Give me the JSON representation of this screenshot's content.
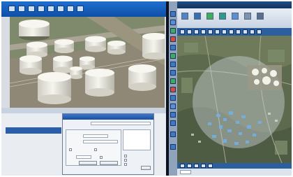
{
  "left_window": {
    "title": "",
    "titlebar_icons": [
      "app-icon",
      "file-icon",
      "save-icon",
      "zoom-icon",
      "pan-icon",
      "grid-icon",
      "layers-icon",
      "select-icon"
    ],
    "side_panel": {
      "tab_label": ""
    },
    "dialog": {
      "title": "",
      "buttons": [
        "",
        ""
      ],
      "options": [
        "",
        "",
        ""
      ]
    }
  },
  "right_window": {
    "title": "",
    "ribbon_buttons": [
      "",
      "",
      "",
      "",
      "",
      "",
      ""
    ],
    "status_tab": ""
  },
  "colors": {
    "titlebar": "#1f6fd0",
    "map_toolbar": "#2c5f9e",
    "tank_white": "#efeee6",
    "ground": "#8f8877"
  }
}
